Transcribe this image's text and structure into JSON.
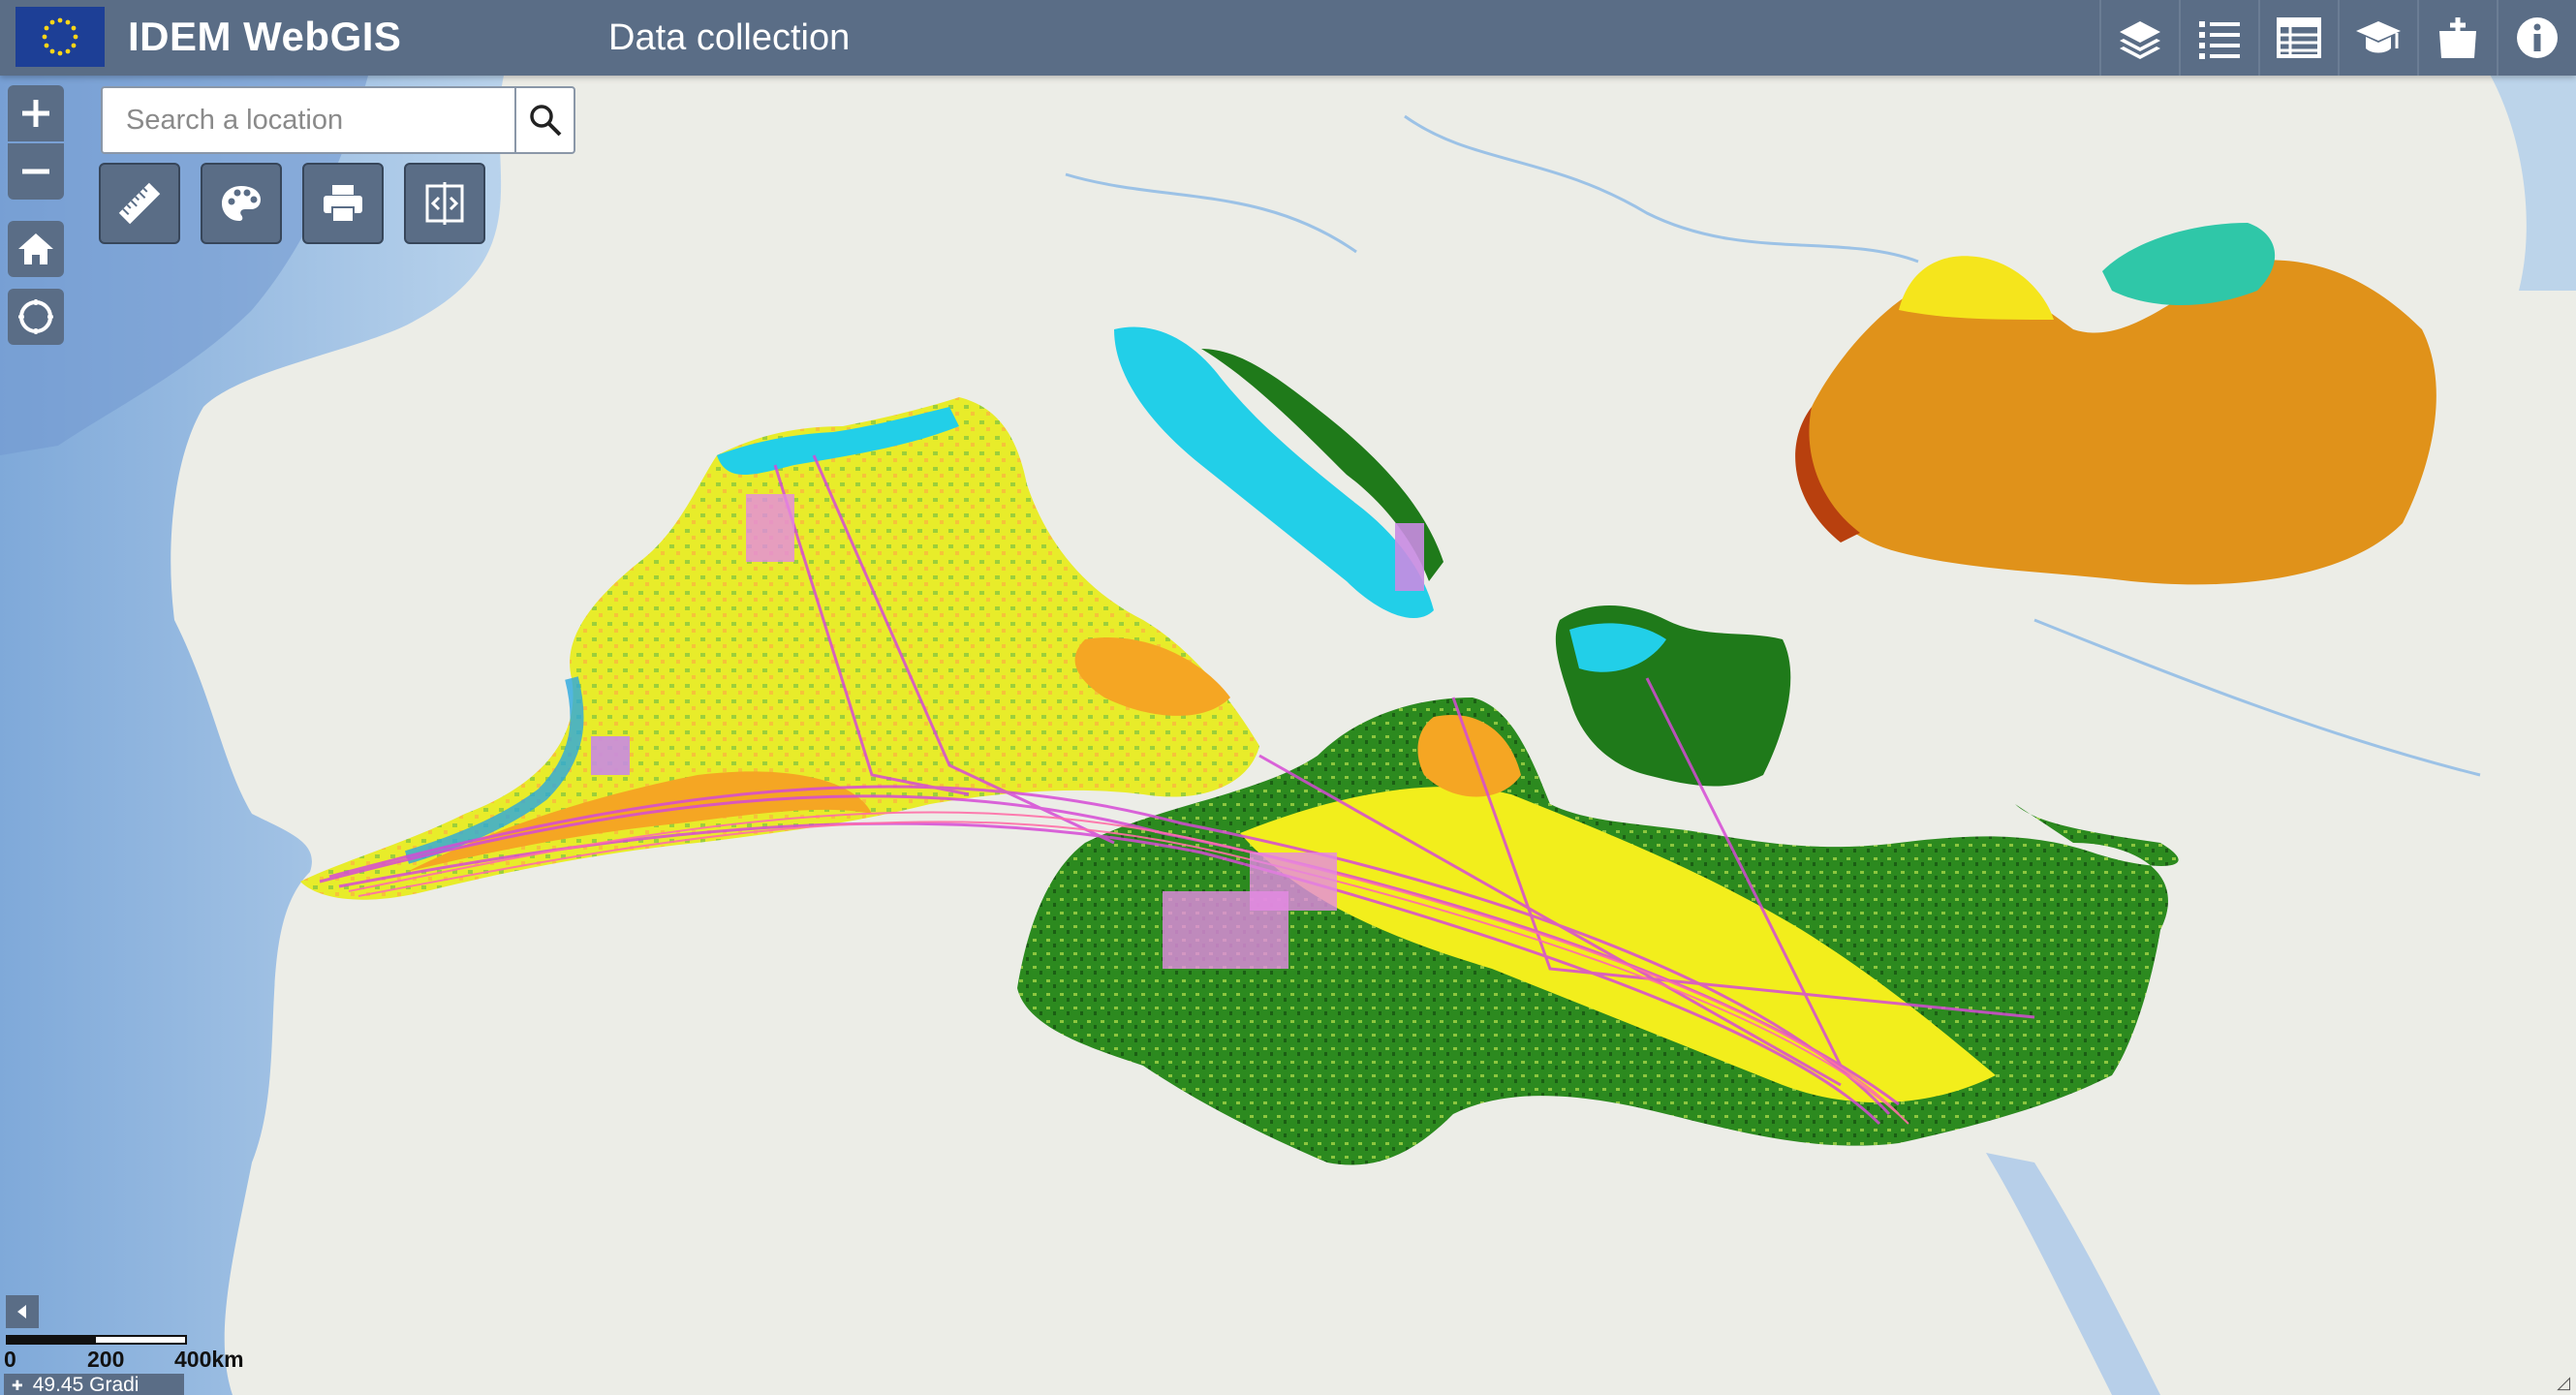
{
  "header": {
    "app_title": "IDEM WebGIS",
    "section_title": "Data collection",
    "logo": "eu-flag-icon",
    "tools": [
      {
        "name": "layers-icon"
      },
      {
        "name": "legend-list-icon"
      },
      {
        "name": "attribute-table-icon"
      },
      {
        "name": "tutorial-icon"
      },
      {
        "name": "add-data-icon"
      },
      {
        "name": "info-icon"
      }
    ]
  },
  "search": {
    "placeholder": "Search a location",
    "value": ""
  },
  "map_tools": [
    {
      "name": "measure-ruler-icon"
    },
    {
      "name": "style-palette-icon"
    },
    {
      "name": "print-icon"
    },
    {
      "name": "compare-swipe-icon"
    }
  ],
  "scalebar": {
    "labels": [
      "0",
      "200",
      "400km"
    ]
  },
  "coordinates": {
    "readout": "49.45 Gradi"
  },
  "colors": {
    "topbar": "#5a6d86",
    "sea": "#a8c8e8",
    "land": "#eceee8",
    "deep_green": "#1f7a1a",
    "light_green": "#8cc63f",
    "yellow": "#f2ee1c",
    "orange": "#f5a623",
    "black_sea": "#e0921a",
    "magenta_routes": "#d64ad6",
    "cyan": "#22cfe8"
  }
}
